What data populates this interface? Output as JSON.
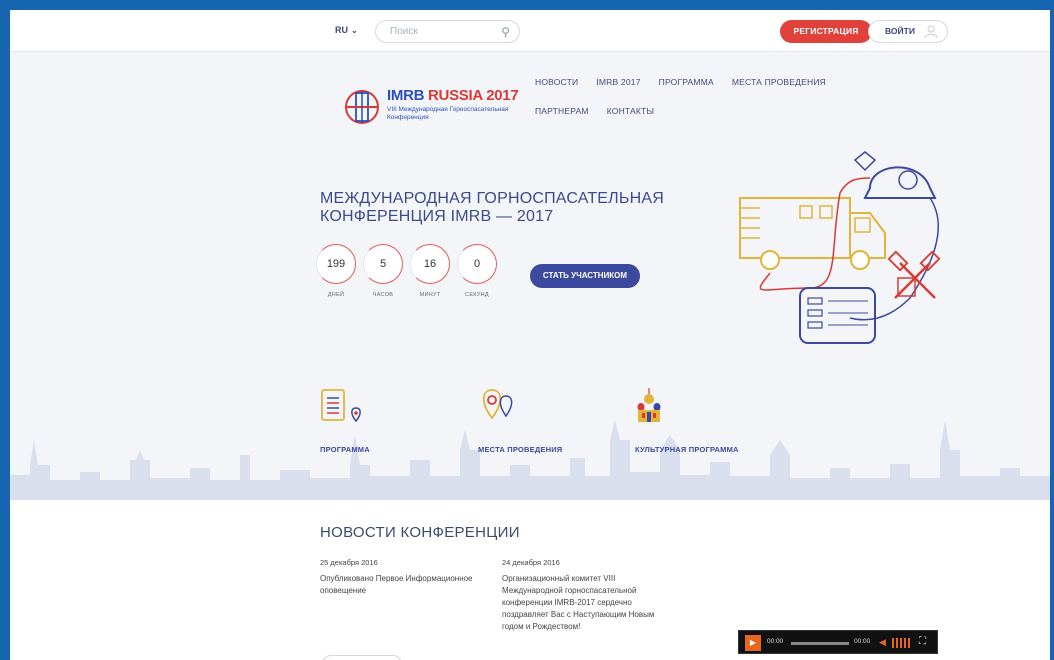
{
  "header": {
    "lang": "RU",
    "search_placeholder": "Поиск",
    "register_label": "РЕГИСТРАЦИЯ",
    "login_label": "ВОЙТИ"
  },
  "logo": {
    "title_blue": "IMRB",
    "title_red": "RUSSIA",
    "title_year": "2017",
    "subtitle": "VIII Международная Горноспасательная Конференция"
  },
  "nav": {
    "items": [
      "НОВОСТИ",
      "IMRB 2017",
      "ПРОГРАММА",
      "МЕСТА ПРОВЕДЕНИЯ",
      "ПАРТНЕРАМ",
      "КОНТАКТЫ"
    ]
  },
  "hero": {
    "title": "МЕЖДУНАРОДНАЯ ГОРНОСПАСАТЕЛЬНАЯ КОНФЕРЕНЦИЯ IMRB — 2017",
    "counters": [
      {
        "value": "199",
        "label": "ДНЕЙ"
      },
      {
        "value": "5",
        "label": "ЧАСОВ"
      },
      {
        "value": "16",
        "label": "МИНУТ"
      },
      {
        "value": "0",
        "label": "СЕКУНД"
      }
    ],
    "cta_label": "СТАТЬ УЧАСТНИКОМ"
  },
  "features": [
    {
      "label": "ПРОГРАММА",
      "icon": "program-icon"
    },
    {
      "label": "МЕСТА ПРОВЕДЕНИЯ",
      "icon": "location-pin-icon"
    },
    {
      "label": "КУЛЬТУРНАЯ ПРОГРАММА",
      "icon": "cathedral-icon"
    }
  ],
  "news": {
    "heading": "НОВОСТИ КОНФЕРЕНЦИИ",
    "items": [
      {
        "date": "25 декабря 2016",
        "text": "Опубликовано Первое Информационное оповещение"
      },
      {
        "date": "24 декабря 2016",
        "text": "Организационный комитет VIII Международной горноспасательной конференции IMRB-2017 сердечно поздравляет Вас с Наступающим Новым годом и Рождеством!"
      }
    ]
  },
  "player": {
    "current_time": "00:00",
    "duration": "00:00"
  },
  "colors": {
    "accent_red": "#e0413a",
    "accent_blue": "#3b4a9e",
    "frame_blue": "#1565b0",
    "player_orange": "#e8671f"
  }
}
